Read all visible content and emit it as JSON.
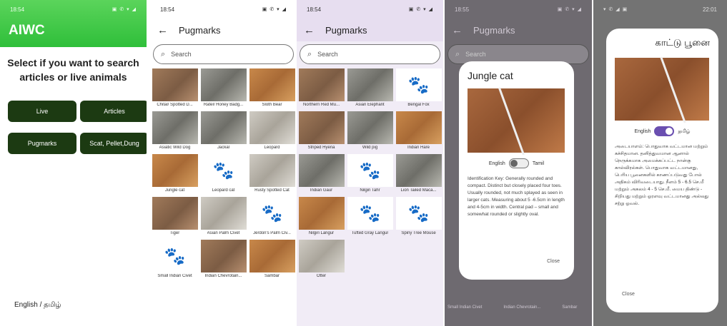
{
  "screen1": {
    "time": "18:54",
    "status_icons": "▣ ✆ ▾ ◢",
    "app_title": "AIWC",
    "prompt": "Select if you want to search articles or live animals",
    "buttons": {
      "live": "Live",
      "articles": "Articles",
      "pugmarks": "Pugmarks",
      "scat": "Scat, Pellet,Dung"
    },
    "language": "English / தமிழ்"
  },
  "screen2": {
    "time": "18:54",
    "status_icons": "▣ ✆ ▾ ◢",
    "title": "Pugmarks",
    "back_icon": "←",
    "search_placeholder": "Search",
    "items": [
      {
        "label": "Chital/ Spotted D...",
        "kind": "photo"
      },
      {
        "label": "Ratel/ Honey Badg...",
        "kind": "photo g"
      },
      {
        "label": "Sloth Bear",
        "kind": "photo o"
      },
      {
        "label": "Asiatic Wild Dog",
        "kind": "photo g"
      },
      {
        "label": "Jackal",
        "kind": "photo g"
      },
      {
        "label": "Leopard",
        "kind": "photo s"
      },
      {
        "label": "Jungle cat",
        "kind": "photo o"
      },
      {
        "label": "Leopard cat",
        "kind": "paw"
      },
      {
        "label": "Rusty Spotted Cat",
        "kind": "photo s"
      },
      {
        "label": "Tiger",
        "kind": "photo"
      },
      {
        "label": "Asian Palm Civet",
        "kind": "photo s"
      },
      {
        "label": "Jerdon's Palm Civ...",
        "kind": "paw"
      },
      {
        "label": "Small Indian Civet",
        "kind": "paw"
      },
      {
        "label": "Indian Chevrotain...",
        "kind": "photo"
      },
      {
        "label": "Sambar",
        "kind": "photo o"
      }
    ]
  },
  "screen3": {
    "time": "18:54",
    "status_icons": "▣ ✆ ▾ ◢",
    "title": "Pugmarks",
    "back_icon": "←",
    "search_placeholder": "Search",
    "items": [
      {
        "label": "Northern Red Mu...",
        "kind": "photo"
      },
      {
        "label": "Asian Elephant",
        "kind": "photo g"
      },
      {
        "label": "Bengal Fox",
        "kind": "paw"
      },
      {
        "label": "Striped Hyena",
        "kind": "photo"
      },
      {
        "label": "Wild pig",
        "kind": "photo g"
      },
      {
        "label": "Indian Hare",
        "kind": "photo o"
      },
      {
        "label": "Indian Gaur",
        "kind": "photo g"
      },
      {
        "label": "Nilgiri Tahr",
        "kind": "paw"
      },
      {
        "label": "Lion Tailed Maca...",
        "kind": "photo g"
      },
      {
        "label": "Nilgiri Langur",
        "kind": "photo o"
      },
      {
        "label": "Tufted Gray Langur",
        "kind": "paw"
      },
      {
        "label": "Spiny Tree Mouse",
        "kind": "paw"
      },
      {
        "label": "Otter",
        "kind": "photo s"
      }
    ]
  },
  "screen4": {
    "time": "18:55",
    "status_icons": "▣ ✆ ▾ ◢",
    "title": "Pugmarks",
    "back_icon": "←",
    "search_placeholder": "Search",
    "dialog_title": "Jungle cat",
    "toggle_left": "English",
    "toggle_right": "Tamil",
    "dialog_text": "Identification Key: Generally rounded and compact. Distinct but closely placed four toes. Usually rounded, not much splayed as seen in larger cats. Measuring about 5 -6.5cm in length and 4-5cm in width. Central pad – small and somewhat rounded or slightly oval.",
    "close_label": "Close",
    "background_labels": [
      "Small Indian Civet",
      "Indian Chevrotain...",
      "Sambar"
    ]
  },
  "screen5": {
    "time": "22:01",
    "status_icons": "▾ ✆ ◢ ▣",
    "dialog_title": "காட்டு பூனை",
    "toggle_left": "English",
    "toggle_right": "தமிழ்",
    "dialog_text": "அடையாளம்: பொதுவாக வட்டமான மற்றும் கச்சிதமான. தனித்துவமான ஆனால் நெருக்கமாக அமைக்கப்பட்ட நான்கு கால்விரல்கள். பொதுவாக வட்டமானது, பெரிய பூனைகளில் காணப்படுவது போல் அதிகம் விரிவடையாது. நீளம் 5 - 6.5 செ.மீ மற்றும் அகலம் 4 - 5 செ.மீ. மைய திண்டு - சிறியது மற்றும் ஓரளவு வட்டமானது அல்லது சற்று ஓவல்.",
    "close_label": "Close"
  },
  "icons": {
    "paw": "paw-icon",
    "search": "search-icon",
    "back": "back-arrow-icon"
  },
  "colors": {
    "brand_green": "#2fbf3a",
    "button_dark": "#1c3a12",
    "toggle_on": "#6a4fb0"
  }
}
